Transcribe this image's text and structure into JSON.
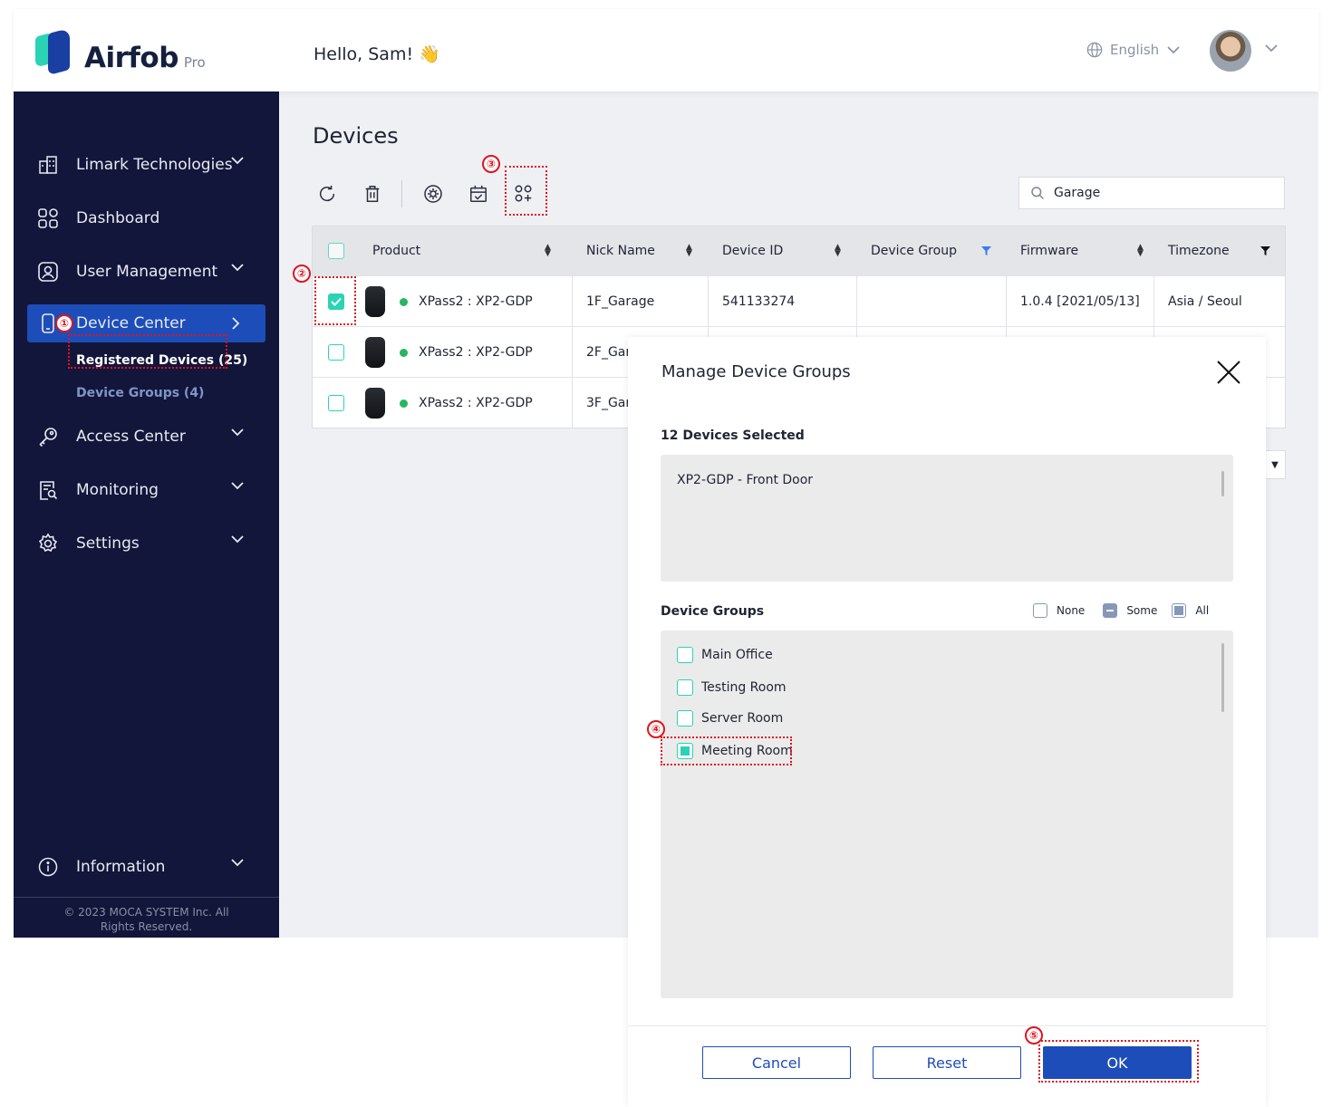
{
  "header": {
    "brand": "Airfob",
    "brand_suffix": "Pro",
    "greeting": "Hello, Sam! 👋",
    "language": "English"
  },
  "sidebar": {
    "items": [
      {
        "label": "Limark Technologies",
        "icon": "building-icon"
      },
      {
        "label": "Dashboard",
        "icon": "grid-icon"
      },
      {
        "label": "User Management",
        "icon": "user-icon"
      },
      {
        "label": "Device Center",
        "icon": "phone-icon"
      },
      {
        "label": "Access Center",
        "icon": "key-icon"
      },
      {
        "label": "Monitoring",
        "icon": "report-search-icon"
      },
      {
        "label": "Settings",
        "icon": "gear-icon"
      },
      {
        "label": "Information",
        "icon": "info-icon"
      }
    ],
    "subitems": [
      "Registered Devices (25)",
      "Device Groups  (4)"
    ],
    "footer": "© 2023 MOCA SYSTEM Inc. All Rights Reserved."
  },
  "main": {
    "title": "Devices",
    "search_value": "Garage"
  },
  "table": {
    "columns": [
      "Product",
      "Nick Name",
      "Device ID",
      "Device Group",
      "Firmware",
      "Timezone"
    ],
    "rows": [
      {
        "product": "XPass2 : XP2-GDP",
        "nickname": "1F_Garage",
        "device_id": "541133274",
        "group": "",
        "firmware": "1.0.4 [2021/05/13]",
        "timezone": "Asia / Seoul",
        "checked": true
      },
      {
        "product": "XPass2 : XP2-GDP",
        "nickname": "2F_Gar",
        "checked": false
      },
      {
        "product": "XPass2 : XP2-GDP",
        "nickname": "3F_Gar",
        "checked": false
      }
    ]
  },
  "modal": {
    "title": "Manage Device Groups",
    "selected_label": "12 Devices Selected",
    "selected_item": "XP2-GDP - Front Door",
    "groups_label": "Device Groups",
    "legend": [
      "None",
      "Some",
      "All"
    ],
    "groups": [
      {
        "label": "Main Office",
        "checked": false
      },
      {
        "label": "Testing Room",
        "checked": false
      },
      {
        "label": "Server Room",
        "checked": false
      },
      {
        "label": "Meeting Room",
        "checked": true
      }
    ],
    "buttons": {
      "cancel": "Cancel",
      "reset": "Reset",
      "ok": "OK"
    }
  },
  "annotations": [
    "①",
    "②",
    "③",
    "④",
    "⑤"
  ],
  "colors": {
    "sidebar": "#12163a",
    "accent": "#1d4db8",
    "teal": "#2bd3b5",
    "annotation": "#e0141e"
  }
}
